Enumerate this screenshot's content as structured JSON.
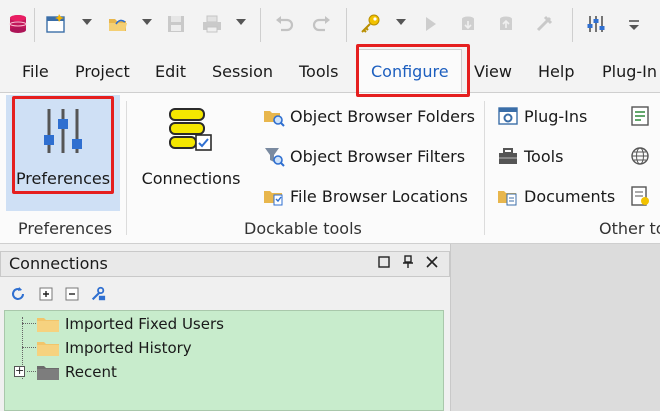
{
  "menu": {
    "tabs": [
      "File",
      "Project",
      "Edit",
      "Session",
      "Tools",
      "Configure",
      "View",
      "Help",
      "Plug-In"
    ],
    "active": "Configure"
  },
  "ribbon": {
    "preferences_group": {
      "button": "Preferences",
      "label": "Preferences"
    },
    "dockable_group": {
      "connections": "Connections",
      "object_browser_folders": "Object Browser Folders",
      "object_browser_filters": "Object Browser Filters",
      "file_browser_locations": "File Browser Locations",
      "label": "Dockable tools"
    },
    "other_group": {
      "plugins": "Plug-Ins",
      "tools": "Tools",
      "documents": "Documents",
      "label": "Other to"
    }
  },
  "panel": {
    "title": "Connections",
    "tree": [
      "Imported Fixed Users",
      "Imported History",
      "Recent"
    ]
  },
  "colors": {
    "highlight": "#e51f1f",
    "accent": "#1d5fbf",
    "tree_bg": "#c8eccc"
  }
}
